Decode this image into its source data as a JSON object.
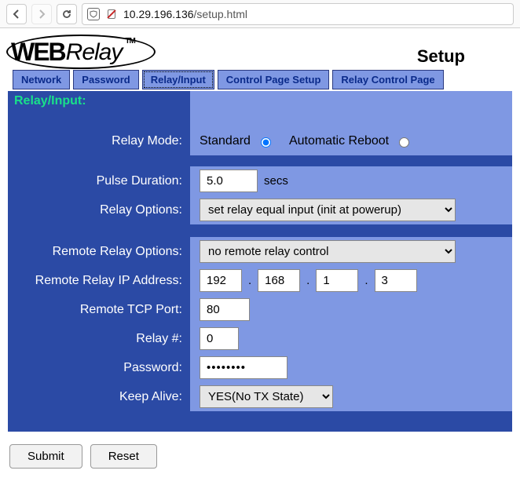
{
  "browser": {
    "url_host": "10.29.196.136",
    "url_path": "/setup.html"
  },
  "header": {
    "logo_web": "WEB",
    "logo_relay": "Relay",
    "logo_tm": "TM",
    "title": "Setup"
  },
  "tabs": {
    "network": "Network",
    "password": "Password",
    "relay_input": "Relay/Input",
    "control_page_setup": "Control Page Setup",
    "relay_control_page": "Relay Control Page"
  },
  "section_label": "Relay/Input:",
  "labels": {
    "relay_mode": "Relay Mode:",
    "pulse_duration": "Pulse Duration:",
    "relay_options": "Relay Options:",
    "remote_relay_options": "Remote Relay Options:",
    "remote_ip": "Remote Relay IP Address:",
    "remote_port": "Remote TCP Port:",
    "relay_num": "Relay #:",
    "password": "Password:",
    "keep_alive": "Keep Alive:"
  },
  "relay_mode": {
    "standard": "Standard",
    "auto_reboot": "Automatic Reboot"
  },
  "pulse": {
    "value": "5.0",
    "unit": "secs"
  },
  "relay_options": {
    "selected": "set relay equal input (init at powerup)"
  },
  "remote_relay_options": {
    "selected": "no remote relay control"
  },
  "remote_ip": {
    "a": "192",
    "b": "168",
    "c": "1",
    "d": "3"
  },
  "remote_port": "80",
  "relay_num": "0",
  "password_value": "●●●●●●●●",
  "keep_alive": {
    "selected": "YES(No TX State)"
  },
  "buttons": {
    "submit": "Submit",
    "reset": "Reset"
  }
}
